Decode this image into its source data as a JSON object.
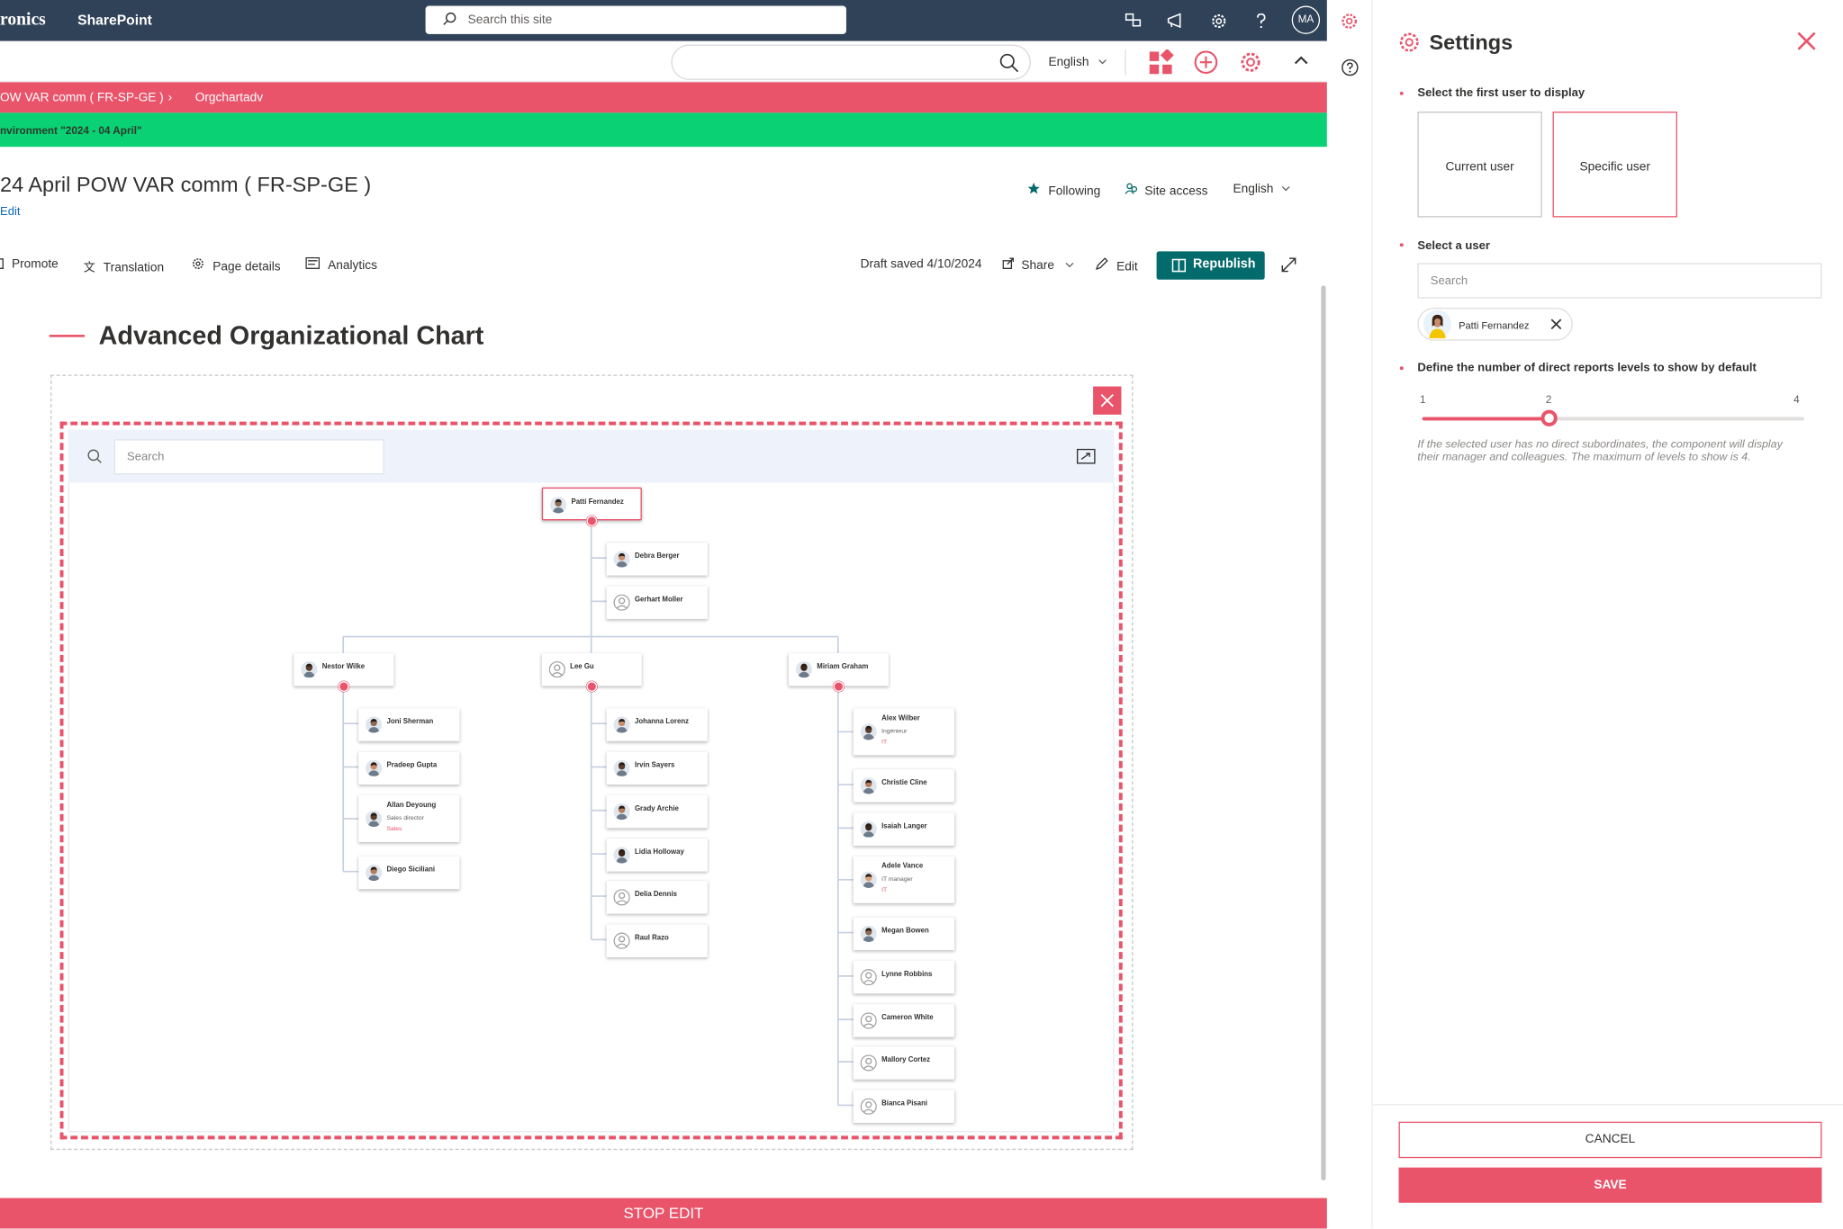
{
  "suite_bar": {
    "brand": "ronics",
    "app_name": "SharePoint",
    "search_placeholder": "Search this site",
    "avatar_initials": "MA"
  },
  "command_bar": {
    "language": "English"
  },
  "breadcrumb": {
    "site": "OW VAR comm ( FR-SP-GE )",
    "page": "Orgchartadv"
  },
  "environment_banner": "nvironment \"2024 - 04 April\"",
  "page_header": {
    "title": "24 April POW VAR comm ( FR-SP-GE )",
    "edit_link": "Edit",
    "following": "Following",
    "site_access": "Site access",
    "language": "English"
  },
  "toolbar": {
    "promote": "Promote",
    "translation": "Translation",
    "page_details": "Page details",
    "analytics": "Analytics",
    "draft_status": "Draft saved 4/10/2024",
    "share": "Share",
    "edit": "Edit",
    "republish": "Republish"
  },
  "webpart": {
    "title": "Advanced Organizational Chart",
    "search_placeholder": "Search"
  },
  "org_chart": {
    "root": {
      "name": "Patti Fernandez"
    },
    "root_assistants": [
      {
        "name": "Debra Berger"
      },
      {
        "name": "Gerhart Moller"
      }
    ],
    "managers": [
      {
        "name": "Nestor Wilke",
        "reports": [
          {
            "name": "Joni Sherman"
          },
          {
            "name": "Pradeep Gupta"
          },
          {
            "name": "Allan Deyoung",
            "job": "Sales director",
            "dept": "Sales"
          },
          {
            "name": "Diego Siciliani"
          }
        ]
      },
      {
        "name": "Lee Gu",
        "reports": [
          {
            "name": "Johanna Lorenz"
          },
          {
            "name": "Irvin Sayers"
          },
          {
            "name": "Grady Archie"
          },
          {
            "name": "Lidia Holloway"
          },
          {
            "name": "Delia Dennis"
          },
          {
            "name": "Raul Razo"
          }
        ]
      },
      {
        "name": "Miriam Graham",
        "reports": [
          {
            "name": "Alex Wilber",
            "job": "Ingénieur",
            "dept": "IT"
          },
          {
            "name": "Christie Cline"
          },
          {
            "name": "Isaiah Langer"
          },
          {
            "name": "Adele Vance",
            "job": "IT manager",
            "dept": "IT"
          },
          {
            "name": "Megan Bowen"
          },
          {
            "name": "Lynne Robbins"
          },
          {
            "name": "Cameron White"
          },
          {
            "name": "Mallory Cortez"
          },
          {
            "name": "Bianca Pisani"
          }
        ]
      }
    ]
  },
  "footer": {
    "stop_edit": "STOP EDIT"
  },
  "settings_panel": {
    "title": "Settings",
    "first_user_label": "Select the first user to display",
    "option_current": "Current user",
    "option_specific": "Specific user",
    "selected_option": "Specific user",
    "select_user_label": "Select a user",
    "search_placeholder": "Search",
    "selected_user": "Patti Fernandez",
    "levels_label": "Define the number of direct reports levels to show by default",
    "slider": {
      "min": 1,
      "max": 4,
      "value": 2,
      "ticks": [
        "1",
        "2",
        "4"
      ]
    },
    "hint": "If the selected user has no direct subordinates, the component will display their manager and colleagues. The maximum of levels to show is 4.",
    "cancel": "CANCEL",
    "save": "SAVE"
  },
  "colors": {
    "accent": "#e9546b",
    "green_banner": "#0ad173",
    "suite_bar": "#2f4258",
    "republish": "#046b6d"
  }
}
